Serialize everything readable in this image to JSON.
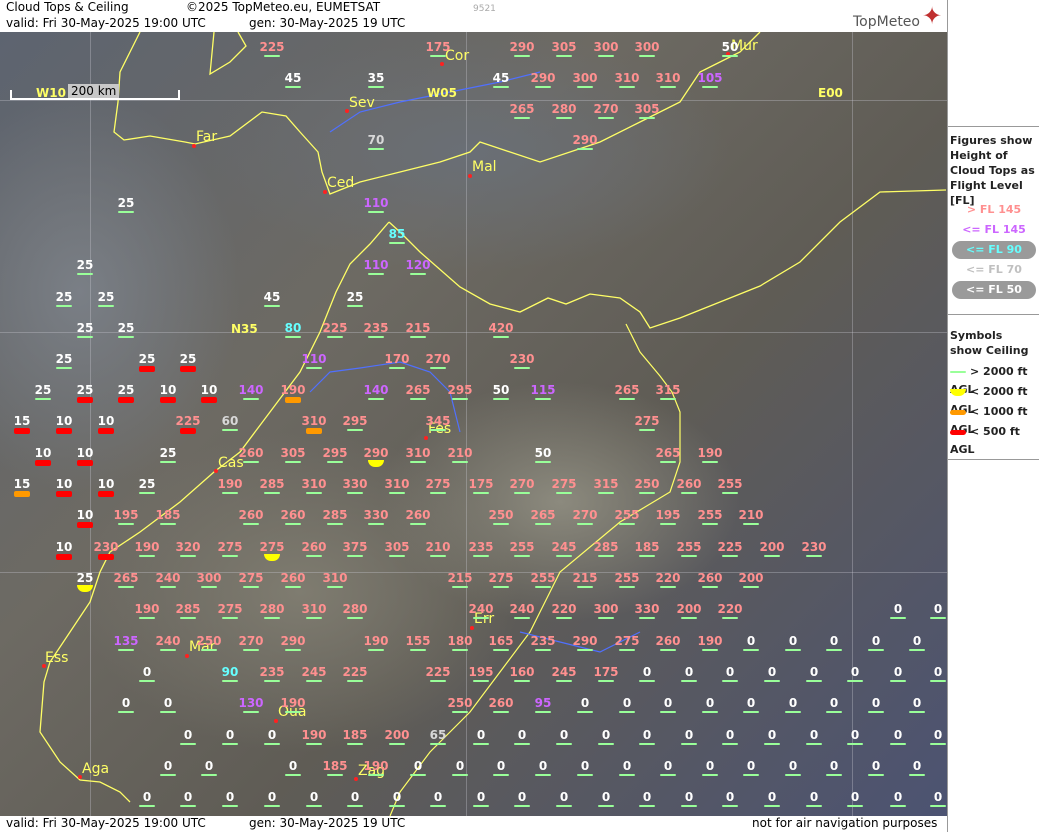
{
  "header": {
    "title": "Cloud Tops & Ceiling",
    "copyright": "©2025 TopMeteo.eu, EUMETSAT",
    "valid": "valid:  Fri  30-May-2025  19:00 UTC",
    "gen": "gen: 30-May-2025 19 UTC",
    "id": "9521"
  },
  "brand": {
    "name": "TopMeteo"
  },
  "footer": {
    "valid": "valid:  Fri  30-May-2025  19:00 UTC",
    "gen": "gen: 30-May-2025 19 UTC",
    "disclaimer": "not for air navigation purposes"
  },
  "scale": {
    "label": "200 km"
  },
  "coords": [
    "W10",
    "W05",
    "E00",
    "N35"
  ],
  "cities": [
    "Cor",
    "Mur",
    "Sev",
    "Far",
    "Ced",
    "Mal",
    "Fes",
    "Cas",
    "Err",
    "Mar",
    "Ess",
    "Oua",
    "Aga",
    "Zag"
  ],
  "colors": {
    "pink": "#ff9090",
    "violet": "#cc66ff",
    "cyan": "#66ffff",
    "light": "#d8d8d8",
    "white": "#ffffff",
    "coast": "#ffff66",
    "river": "#5070ff",
    "ceil_green": "#99ff99",
    "ceil_yellow": "#ffff00",
    "ceil_orange": "#ff9900",
    "ceil_red": "#ff0000"
  },
  "legend": {
    "figures_title": "Figures show Height of Cloud Tops as Flight Level  [FL]",
    "figures": [
      "> FL 145",
      "<= FL 145",
      "<= FL 90",
      "<= FL 70",
      "<= FL 50"
    ],
    "symbols_title": "Symbols show Ceiling",
    "symbols": [
      "> 2000 ft AGL",
      "< 2000 ft AGL",
      "< 1000 ft AGL",
      "< 500 ft AGL"
    ]
  },
  "cloud_tops": [
    {
      "v": "225",
      "c": "pink",
      "k": "g"
    },
    {
      "v": "175",
      "c": "pink",
      "k": "g"
    },
    {
      "v": "290",
      "c": "pink",
      "k": "g"
    },
    {
      "v": "305",
      "c": "pink",
      "k": "g"
    },
    {
      "v": "300",
      "c": "pink",
      "k": "g"
    },
    {
      "v": "300",
      "c": "pink",
      "k": "g"
    },
    {
      "v": "50",
      "c": "white",
      "k": "g"
    },
    {
      "v": "45",
      "c": "white",
      "k": "g"
    },
    {
      "v": "35",
      "c": "white",
      "k": "g"
    },
    {
      "v": "45",
      "c": "white",
      "k": "g"
    },
    {
      "v": "290",
      "c": "pink",
      "k": "g"
    },
    {
      "v": "300",
      "c": "pink",
      "k": "g"
    },
    {
      "v": "310",
      "c": "pink",
      "k": "g"
    },
    {
      "v": "310",
      "c": "pink",
      "k": "g"
    },
    {
      "v": "105",
      "c": "violet",
      "k": "g"
    },
    {
      "v": "265",
      "c": "pink",
      "k": "g"
    },
    {
      "v": "280",
      "c": "pink",
      "k": "g"
    },
    {
      "v": "270",
      "c": "pink",
      "k": "g"
    },
    {
      "v": "305",
      "c": "pink",
      "k": "g"
    },
    {
      "v": "70",
      "c": "light",
      "k": "g"
    },
    {
      "v": "290",
      "c": "pink",
      "k": "g"
    },
    {
      "v": "25",
      "c": "white",
      "k": "g"
    },
    {
      "v": "110",
      "c": "violet",
      "k": "g"
    },
    {
      "v": "85",
      "c": "cyan",
      "k": "g"
    },
    {
      "v": "25",
      "c": "white",
      "k": "g"
    },
    {
      "v": "110",
      "c": "violet",
      "k": "g"
    },
    {
      "v": "120",
      "c": "violet",
      "k": "g"
    },
    {
      "v": "25",
      "c": "white",
      "k": "g"
    },
    {
      "v": "25",
      "c": "white",
      "k": "g"
    },
    {
      "v": "45",
      "c": "white",
      "k": "g"
    },
    {
      "v": "25",
      "c": "white",
      "k": "g"
    },
    {
      "v": "25",
      "c": "white",
      "k": "g"
    },
    {
      "v": "25",
      "c": "white",
      "k": "g"
    },
    {
      "v": "80",
      "c": "cyan",
      "k": "g"
    },
    {
      "v": "225",
      "c": "pink",
      "k": "g"
    },
    {
      "v": "235",
      "c": "pink",
      "k": "g"
    },
    {
      "v": "215",
      "c": "pink",
      "k": "g"
    },
    {
      "v": "420",
      "c": "pink",
      "k": "g"
    },
    {
      "v": "25",
      "c": "white",
      "k": "g"
    },
    {
      "v": "25",
      "c": "white",
      "k": "r"
    },
    {
      "v": "25",
      "c": "white",
      "k": "r"
    },
    {
      "v": "110",
      "c": "violet",
      "k": "g"
    },
    {
      "v": "170",
      "c": "pink",
      "k": "g"
    },
    {
      "v": "270",
      "c": "pink",
      "k": "g"
    },
    {
      "v": "230",
      "c": "pink",
      "k": "g"
    },
    {
      "v": "25",
      "c": "white",
      "k": "g"
    },
    {
      "v": "25",
      "c": "white",
      "k": "r"
    },
    {
      "v": "25",
      "c": "white",
      "k": "r"
    },
    {
      "v": "10",
      "c": "white",
      "k": "r"
    },
    {
      "v": "10",
      "c": "white",
      "k": "r"
    },
    {
      "v": "140",
      "c": "violet",
      "k": "g"
    },
    {
      "v": "190",
      "c": "pink",
      "k": "o"
    },
    {
      "v": "140",
      "c": "violet",
      "k": "g"
    },
    {
      "v": "265",
      "c": "pink",
      "k": "g"
    },
    {
      "v": "295",
      "c": "pink",
      "k": "g"
    },
    {
      "v": "50",
      "c": "white",
      "k": "g"
    },
    {
      "v": "115",
      "c": "violet",
      "k": "g"
    },
    {
      "v": "265",
      "c": "pink",
      "k": "g"
    },
    {
      "v": "315",
      "c": "pink",
      "k": "g"
    },
    {
      "v": "15",
      "c": "white",
      "k": "r"
    },
    {
      "v": "10",
      "c": "white",
      "k": "r"
    },
    {
      "v": "10",
      "c": "white",
      "k": "r"
    },
    {
      "v": "225",
      "c": "pink",
      "k": "r"
    },
    {
      "v": "60",
      "c": "light",
      "k": "g"
    },
    {
      "v": "310",
      "c": "pink",
      "k": "o"
    },
    {
      "v": "295",
      "c": "pink",
      "k": "g"
    },
    {
      "v": "345",
      "c": "pink",
      "k": "g"
    },
    {
      "v": "275",
      "c": "pink",
      "k": "g"
    },
    {
      "v": "10",
      "c": "white",
      "k": "r"
    },
    {
      "v": "10",
      "c": "white",
      "k": "r"
    },
    {
      "v": "25",
      "c": "white",
      "k": "g"
    },
    {
      "v": "260",
      "c": "pink",
      "k": "g"
    },
    {
      "v": "305",
      "c": "pink",
      "k": "g"
    },
    {
      "v": "295",
      "c": "pink",
      "k": "g"
    },
    {
      "v": "290",
      "c": "pink",
      "k": "y"
    },
    {
      "v": "310",
      "c": "pink",
      "k": "g"
    },
    {
      "v": "210",
      "c": "pink",
      "k": "g"
    },
    {
      "v": "50",
      "c": "white",
      "k": "g"
    },
    {
      "v": "265",
      "c": "pink",
      "k": "g"
    },
    {
      "v": "190",
      "c": "pink",
      "k": "g"
    },
    {
      "v": "15",
      "c": "white",
      "k": "o"
    },
    {
      "v": "10",
      "c": "white",
      "k": "r"
    },
    {
      "v": "10",
      "c": "white",
      "k": "r"
    },
    {
      "v": "25",
      "c": "white",
      "k": "g"
    },
    {
      "v": "190",
      "c": "pink",
      "k": "g"
    },
    {
      "v": "285",
      "c": "pink",
      "k": "g"
    },
    {
      "v": "310",
      "c": "pink",
      "k": "g"
    },
    {
      "v": "330",
      "c": "pink",
      "k": "g"
    },
    {
      "v": "310",
      "c": "pink",
      "k": "g"
    },
    {
      "v": "275",
      "c": "pink",
      "k": "g"
    },
    {
      "v": "175",
      "c": "pink",
      "k": "g"
    },
    {
      "v": "270",
      "c": "pink",
      "k": "g"
    },
    {
      "v": "275",
      "c": "pink",
      "k": "g"
    },
    {
      "v": "315",
      "c": "pink",
      "k": "g"
    },
    {
      "v": "250",
      "c": "pink",
      "k": "g"
    },
    {
      "v": "260",
      "c": "pink",
      "k": "g"
    },
    {
      "v": "255",
      "c": "pink",
      "k": "g"
    },
    {
      "v": "10",
      "c": "white",
      "k": "r"
    },
    {
      "v": "195",
      "c": "pink",
      "k": "g"
    },
    {
      "v": "185",
      "c": "pink",
      "k": "g"
    },
    {
      "v": "260",
      "c": "pink",
      "k": "g"
    },
    {
      "v": "260",
      "c": "pink",
      "k": "g"
    },
    {
      "v": "285",
      "c": "pink",
      "k": "g"
    },
    {
      "v": "330",
      "c": "pink",
      "k": "g"
    },
    {
      "v": "260",
      "c": "pink",
      "k": "g"
    },
    {
      "v": "250",
      "c": "pink",
      "k": "g"
    },
    {
      "v": "265",
      "c": "pink",
      "k": "g"
    },
    {
      "v": "270",
      "c": "pink",
      "k": "g"
    },
    {
      "v": "255",
      "c": "pink",
      "k": "g"
    },
    {
      "v": "195",
      "c": "pink",
      "k": "g"
    },
    {
      "v": "255",
      "c": "pink",
      "k": "g"
    },
    {
      "v": "210",
      "c": "pink",
      "k": "g"
    },
    {
      "v": "10",
      "c": "white",
      "k": "r"
    },
    {
      "v": "230",
      "c": "pink",
      "k": "r"
    },
    {
      "v": "190",
      "c": "pink",
      "k": "g"
    },
    {
      "v": "320",
      "c": "pink",
      "k": "g"
    },
    {
      "v": "275",
      "c": "pink",
      "k": "g"
    },
    {
      "v": "275",
      "c": "pink",
      "k": "y"
    },
    {
      "v": "260",
      "c": "pink",
      "k": "g"
    },
    {
      "v": "375",
      "c": "pink",
      "k": "g"
    },
    {
      "v": "305",
      "c": "pink",
      "k": "g"
    },
    {
      "v": "210",
      "c": "pink",
      "k": "g"
    },
    {
      "v": "235",
      "c": "pink",
      "k": "g"
    },
    {
      "v": "255",
      "c": "pink",
      "k": "g"
    },
    {
      "v": "245",
      "c": "pink",
      "k": "g"
    },
    {
      "v": "285",
      "c": "pink",
      "k": "g"
    },
    {
      "v": "185",
      "c": "pink",
      "k": "g"
    },
    {
      "v": "255",
      "c": "pink",
      "k": "g"
    },
    {
      "v": "225",
      "c": "pink",
      "k": "g"
    },
    {
      "v": "200",
      "c": "pink",
      "k": "g"
    },
    {
      "v": "230",
      "c": "pink",
      "k": "g"
    },
    {
      "v": "25",
      "c": "white",
      "k": "y"
    },
    {
      "v": "265",
      "c": "pink",
      "k": "g"
    },
    {
      "v": "240",
      "c": "pink",
      "k": "g"
    },
    {
      "v": "300",
      "c": "pink",
      "k": "g"
    },
    {
      "v": "275",
      "c": "pink",
      "k": "g"
    },
    {
      "v": "260",
      "c": "pink",
      "k": "g"
    },
    {
      "v": "310",
      "c": "pink",
      "k": "g"
    },
    {
      "v": "215",
      "c": "pink",
      "k": "g"
    },
    {
      "v": "275",
      "c": "pink",
      "k": "g"
    },
    {
      "v": "255",
      "c": "pink",
      "k": "g"
    },
    {
      "v": "215",
      "c": "pink",
      "k": "g"
    },
    {
      "v": "255",
      "c": "pink",
      "k": "g"
    },
    {
      "v": "220",
      "c": "pink",
      "k": "g"
    },
    {
      "v": "260",
      "c": "pink",
      "k": "g"
    },
    {
      "v": "200",
      "c": "pink",
      "k": "g"
    },
    {
      "v": "190",
      "c": "pink",
      "k": "g"
    },
    {
      "v": "285",
      "c": "pink",
      "k": "g"
    },
    {
      "v": "275",
      "c": "pink",
      "k": "g"
    },
    {
      "v": "280",
      "c": "pink",
      "k": "g"
    },
    {
      "v": "310",
      "c": "pink",
      "k": "g"
    },
    {
      "v": "280",
      "c": "pink",
      "k": "g"
    },
    {
      "v": "240",
      "c": "pink",
      "k": "g"
    },
    {
      "v": "240",
      "c": "pink",
      "k": "g"
    },
    {
      "v": "220",
      "c": "pink",
      "k": "g"
    },
    {
      "v": "300",
      "c": "pink",
      "k": "g"
    },
    {
      "v": "330",
      "c": "pink",
      "k": "g"
    },
    {
      "v": "200",
      "c": "pink",
      "k": "g"
    },
    {
      "v": "220",
      "c": "pink",
      "k": "g"
    },
    {
      "v": "0",
      "c": "white",
      "k": "g"
    },
    {
      "v": "0",
      "c": "white",
      "k": "g"
    },
    {
      "v": "135",
      "c": "violet",
      "k": "g"
    },
    {
      "v": "240",
      "c": "pink",
      "k": "g"
    },
    {
      "v": "250",
      "c": "pink",
      "k": "g"
    },
    {
      "v": "270",
      "c": "pink",
      "k": "g"
    },
    {
      "v": "290",
      "c": "pink",
      "k": "g"
    },
    {
      "v": "190",
      "c": "pink",
      "k": "g"
    },
    {
      "v": "155",
      "c": "pink",
      "k": "g"
    },
    {
      "v": "180",
      "c": "pink",
      "k": "g"
    },
    {
      "v": "165",
      "c": "pink",
      "k": "g"
    },
    {
      "v": "235",
      "c": "pink",
      "k": "g"
    },
    {
      "v": "290",
      "c": "pink",
      "k": "g"
    },
    {
      "v": "275",
      "c": "pink",
      "k": "g"
    },
    {
      "v": "260",
      "c": "pink",
      "k": "g"
    },
    {
      "v": "190",
      "c": "pink",
      "k": "g"
    },
    {
      "v": "0",
      "c": "white",
      "k": "g"
    },
    {
      "v": "0",
      "c": "white",
      "k": "g"
    },
    {
      "v": "0",
      "c": "white",
      "k": "g"
    },
    {
      "v": "0",
      "c": "white",
      "k": "g"
    },
    {
      "v": "0",
      "c": "white",
      "k": "g"
    },
    {
      "v": "0",
      "c": "white",
      "k": "g"
    },
    {
      "v": "90",
      "c": "cyan",
      "k": "g"
    },
    {
      "v": "235",
      "c": "pink",
      "k": "g"
    },
    {
      "v": "245",
      "c": "pink",
      "k": "g"
    },
    {
      "v": "225",
      "c": "pink",
      "k": "g"
    },
    {
      "v": "225",
      "c": "pink",
      "k": "g"
    },
    {
      "v": "195",
      "c": "pink",
      "k": "g"
    },
    {
      "v": "160",
      "c": "pink",
      "k": "g"
    },
    {
      "v": "245",
      "c": "pink",
      "k": "g"
    },
    {
      "v": "175",
      "c": "pink",
      "k": "g"
    },
    {
      "v": "0",
      "c": "white",
      "k": "g"
    },
    {
      "v": "0",
      "c": "white",
      "k": "g"
    },
    {
      "v": "0",
      "c": "white",
      "k": "g"
    },
    {
      "v": "0",
      "c": "white",
      "k": "g"
    },
    {
      "v": "0",
      "c": "white",
      "k": "g"
    },
    {
      "v": "0",
      "c": "white",
      "k": "g"
    },
    {
      "v": "0",
      "c": "white",
      "k": "g"
    },
    {
      "v": "0",
      "c": "white",
      "k": "g"
    },
    {
      "v": "0",
      "c": "white",
      "k": "g"
    },
    {
      "v": "0",
      "c": "white",
      "k": "g"
    },
    {
      "v": "130",
      "c": "violet",
      "k": "g"
    },
    {
      "v": "190",
      "c": "pink",
      "k": "g"
    },
    {
      "v": "250",
      "c": "pink",
      "k": "g"
    },
    {
      "v": "260",
      "c": "pink",
      "k": "g"
    },
    {
      "v": "95",
      "c": "violet",
      "k": "g"
    },
    {
      "v": "0",
      "c": "white",
      "k": "g"
    },
    {
      "v": "0",
      "c": "white",
      "k": "g"
    },
    {
      "v": "0",
      "c": "white",
      "k": "g"
    },
    {
      "v": "0",
      "c": "white",
      "k": "g"
    },
    {
      "v": "0",
      "c": "white",
      "k": "g"
    },
    {
      "v": "0",
      "c": "white",
      "k": "g"
    },
    {
      "v": "0",
      "c": "white",
      "k": "g"
    },
    {
      "v": "0",
      "c": "white",
      "k": "g"
    },
    {
      "v": "0",
      "c": "white",
      "k": "g"
    },
    {
      "v": "0",
      "c": "white",
      "k": "g"
    },
    {
      "v": "0",
      "c": "white",
      "k": "g"
    },
    {
      "v": "0",
      "c": "white",
      "k": "g"
    },
    {
      "v": "190",
      "c": "pink",
      "k": "g"
    },
    {
      "v": "185",
      "c": "pink",
      "k": "g"
    },
    {
      "v": "200",
      "c": "pink",
      "k": "g"
    },
    {
      "v": "65",
      "c": "light",
      "k": "g"
    },
    {
      "v": "0",
      "c": "white",
      "k": "g"
    },
    {
      "v": "0",
      "c": "white",
      "k": "g"
    },
    {
      "v": "0",
      "c": "white",
      "k": "g"
    },
    {
      "v": "0",
      "c": "white",
      "k": "g"
    },
    {
      "v": "0",
      "c": "white",
      "k": "g"
    },
    {
      "v": "0",
      "c": "white",
      "k": "g"
    },
    {
      "v": "0",
      "c": "white",
      "k": "g"
    },
    {
      "v": "0",
      "c": "white",
      "k": "g"
    },
    {
      "v": "0",
      "c": "white",
      "k": "g"
    },
    {
      "v": "0",
      "c": "white",
      "k": "g"
    },
    {
      "v": "0",
      "c": "white",
      "k": "g"
    },
    {
      "v": "0",
      "c": "white",
      "k": "g"
    },
    {
      "v": "0",
      "c": "white",
      "k": "g"
    },
    {
      "v": "0",
      "c": "white",
      "k": "g"
    },
    {
      "v": "0",
      "c": "white",
      "k": "g"
    },
    {
      "v": "185",
      "c": "pink",
      "k": "g"
    },
    {
      "v": "190",
      "c": "pink",
      "k": "g"
    },
    {
      "v": "0",
      "c": "white",
      "k": "g"
    },
    {
      "v": "0",
      "c": "white",
      "k": "g"
    },
    {
      "v": "0",
      "c": "white",
      "k": "g"
    },
    {
      "v": "0",
      "c": "white",
      "k": "g"
    },
    {
      "v": "0",
      "c": "white",
      "k": "g"
    },
    {
      "v": "0",
      "c": "white",
      "k": "g"
    },
    {
      "v": "0",
      "c": "white",
      "k": "g"
    },
    {
      "v": "0",
      "c": "white",
      "k": "g"
    },
    {
      "v": "0",
      "c": "white",
      "k": "g"
    },
    {
      "v": "0",
      "c": "white",
      "k": "g"
    },
    {
      "v": "0",
      "c": "white",
      "k": "g"
    },
    {
      "v": "0",
      "c": "white",
      "k": "g"
    },
    {
      "v": "0",
      "c": "white",
      "k": "g"
    },
    {
      "v": "0",
      "c": "white",
      "k": "g"
    },
    {
      "v": "0",
      "c": "white",
      "k": "g"
    },
    {
      "v": "0",
      "c": "white",
      "k": "g"
    },
    {
      "v": "0",
      "c": "white",
      "k": "g"
    },
    {
      "v": "0",
      "c": "white",
      "k": "g"
    },
    {
      "v": "0",
      "c": "white",
      "k": "g"
    },
    {
      "v": "0",
      "c": "white",
      "k": "g"
    },
    {
      "v": "0",
      "c": "white",
      "k": "g"
    },
    {
      "v": "0",
      "c": "white",
      "k": "g"
    },
    {
      "v": "0",
      "c": "white",
      "k": "g"
    },
    {
      "v": "0",
      "c": "white",
      "k": "g"
    },
    {
      "v": "0",
      "c": "white",
      "k": "g"
    },
    {
      "v": "0",
      "c": "white",
      "k": "g"
    },
    {
      "v": "0",
      "c": "white",
      "k": "g"
    },
    {
      "v": "0",
      "c": "white",
      "k": "g"
    },
    {
      "v": "0",
      "c": "white",
      "k": "g"
    },
    {
      "v": "0",
      "c": "white",
      "k": "g"
    },
    {
      "v": "0",
      "c": "white",
      "k": "g"
    },
    {
      "v": "0",
      "c": "white",
      "k": "g"
    },
    {
      "v": "0",
      "c": "white",
      "k": "g"
    },
    {
      "v": "0",
      "c": "white",
      "k": "g"
    },
    {
      "v": "0",
      "c": "white",
      "k": "g"
    },
    {
      "v": "0",
      "c": "white",
      "k": "g"
    }
  ]
}
